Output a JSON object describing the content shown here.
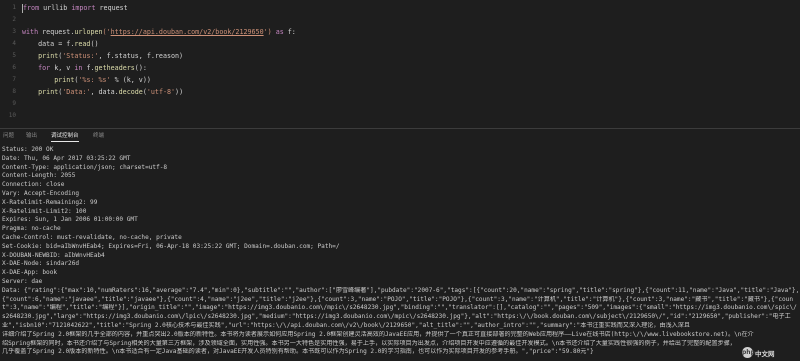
{
  "editor": {
    "line_numbers": [
      "1",
      "2",
      "3",
      "4",
      "5",
      "6",
      "7",
      "8",
      "9",
      "10"
    ],
    "lines": [
      [
        {
          "t": "from",
          "c": "kw"
        },
        {
          "t": " urllib ",
          "c": "plain"
        },
        {
          "t": "import",
          "c": "kw"
        },
        {
          "t": " request",
          "c": "plain"
        }
      ],
      [],
      [
        {
          "t": "with",
          "c": "kw"
        },
        {
          "t": " request.",
          "c": "plain"
        },
        {
          "t": "urlopen",
          "c": "bi"
        },
        {
          "t": "('",
          "c": "str"
        },
        {
          "t": "https://api.douban.com/v2/book/2129650",
          "c": "url"
        },
        {
          "t": "')",
          "c": "str"
        },
        {
          "t": " as ",
          "c": "kw"
        },
        {
          "t": "f:",
          "c": "plain"
        }
      ],
      [
        {
          "t": "    data = f.",
          "c": "plain"
        },
        {
          "t": "read",
          "c": "bi"
        },
        {
          "t": "()",
          "c": "plain"
        }
      ],
      [
        {
          "t": "    ",
          "c": "plain"
        },
        {
          "t": "print",
          "c": "bi"
        },
        {
          "t": "(",
          "c": "plain"
        },
        {
          "t": "'Status:'",
          "c": "str"
        },
        {
          "t": ", f.status, f.reason)",
          "c": "plain"
        }
      ],
      [
        {
          "t": "    ",
          "c": "plain"
        },
        {
          "t": "for",
          "c": "kw"
        },
        {
          "t": " k, v ",
          "c": "plain"
        },
        {
          "t": "in",
          "c": "kw"
        },
        {
          "t": " f.",
          "c": "plain"
        },
        {
          "t": "getheaders",
          "c": "bi"
        },
        {
          "t": "():",
          "c": "plain"
        }
      ],
      [
        {
          "t": "        ",
          "c": "plain"
        },
        {
          "t": "print",
          "c": "bi"
        },
        {
          "t": "(",
          "c": "plain"
        },
        {
          "t": "'%s: %s'",
          "c": "str"
        },
        {
          "t": " % (k, v))",
          "c": "plain"
        }
      ],
      [
        {
          "t": "    ",
          "c": "plain"
        },
        {
          "t": "print",
          "c": "bi"
        },
        {
          "t": "(",
          "c": "plain"
        },
        {
          "t": "'Data:'",
          "c": "str"
        },
        {
          "t": ", data.",
          "c": "plain"
        },
        {
          "t": "decode",
          "c": "bi"
        },
        {
          "t": "(",
          "c": "plain"
        },
        {
          "t": "'utf-8'",
          "c": "str"
        },
        {
          "t": "))",
          "c": "plain"
        }
      ],
      [],
      []
    ]
  },
  "panel": {
    "tabs": [
      {
        "label": "问题",
        "active": false
      },
      {
        "label": "输出",
        "active": false
      },
      {
        "label": "调试控制台",
        "active": true
      },
      {
        "label": "终端",
        "active": false
      }
    ],
    "output_lines": [
      "Status: 200 OK",
      "Date: Thu, 06 Apr 2017 03:25:22 GMT",
      "Content-Type: application/json; charset=utf-8",
      "Content-Length: 2055",
      "Connection: close",
      "Vary: Accept-Encoding",
      "X-Ratelimit-Remaining2: 99",
      "X-Ratelimit-Limit2: 100",
      "Expires: Sun, 1 Jan 2006 01:00:00 GMT",
      "Pragma: no-cache",
      "Cache-Control: must-revalidate, no-cache, private",
      "Set-Cookie: bid=aIbWnvHEab4; Expires=Fri, 06-Apr-18 03:25:22 GMT; Domain=.douban.com; Path=/",
      "X-DOUBAN-NEWBID: aIbWnvHEab4",
      "X-DAE-Node: sindar26d",
      "X-DAE-App: book",
      "Server: dae",
      "Data: {\"rating\":{\"max\":10,\"numRaters\":16,\"average\":\"7.4\",\"min\":0},\"subtitle\":\"\",\"author\":[\"廖雪峰编著\"],\"pubdate\":\"2007-6\",\"tags\":[{\"count\":20,\"name\":\"spring\",\"title\":\"spring\"},{\"count\":11,\"name\":\"Java\",\"title\":\"Java\"},",
      "{\"count\":6,\"name\":\"javaee\",\"title\":\"javaee\"},{\"count\":4,\"name\":\"j2ee\",\"title\":\"j2ee\"},{\"count\":3,\"name\":\"POJO\",\"title\":\"POJO\"},{\"count\":3,\"name\":\"计算机\",\"title\":\"计算机\"},{\"count\":3,\"name\":\"藏书\",\"title\":\"藏书\"},{\"coun",
      "t\":3,\"name\":\"编程\",\"title\":\"编程\"}],\"origin_title\":\"\",\"image\":\"https://img3.doubanio.com\\/mpic\\/s2648230.jpg\",\"binding\":\"\",\"translator\":[],\"catalog\":\"\",\"pages\":\"509\",\"images\":{\"small\":\"https://img3.doubanio.com\\/spic\\/",
      "s2648230.jpg\",\"large\":\"https://img3.doubanio.com\\/lpic\\/s2648230.jpg\",\"medium\":\"https://img3.doubanio.com\\/mpic\\/s2648230.jpg\"},\"alt\":\"https:\\/\\/book.douban.com\\/subject\\/2129650\\/\",\"id\":\"2129650\",\"publisher\":\"电子工",
      "业\",\"isbn10\":\"7121042622\",\"title\":\"Spring 2.0核心技术与最佳实践\",\"url\":\"https:\\/\\/api.douban.com\\/v2\\/book\\/2129650\",\"alt_title\":\"\",\"author_intro\":\"\",\"summary\":\"本书注重实践而又深入理论，由浅入深且",
      "详细介绍了Spring 2.0框架的几乎全部的内容，并重点突出2.0版本的新特性。本书将为读者展示如何应用Spring 2.0框架创建灵活高效的JavaEE应用，并提供了一个真正可直接部署的完整的Web应用程序——Live在线书店(http:\\/\\/www.livebookstore.net)。\\n在介",
      "绍Spring框架的同时，本书还介绍了与Spring相关的大量第三方框架，涉及领域全面，实用性强。本书另一大特色是实用性强，易于上手，以实际项目为出发点，介绍项目开发中应遵循的最佳开发模式。\\n本书还介绍了大量实践性很强的例子，并给出了完整的配置步骤，",
      "几乎覆盖了Spring 2.0版本的新特性。\\n本书适合有一定Java基础的读者，对JavaEE开发人员特别有帮助。本书既可以作为Spring 2.0的学习指南，也可以作为实际项目开发的参考手册。\",\"price\":\"59.80元\"}"
    ]
  },
  "watermark": {
    "logo_text": "php",
    "site_name": "中文网"
  }
}
